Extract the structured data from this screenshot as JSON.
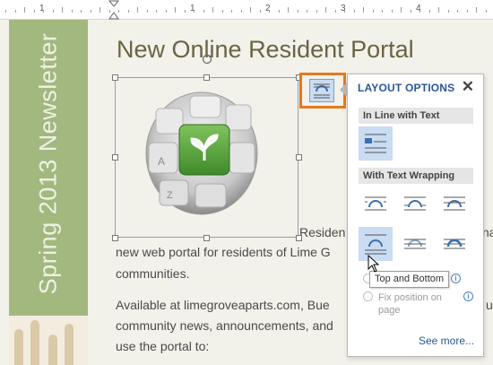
{
  "ruler": {
    "numbers": [
      "1",
      "1",
      "2",
      "3",
      "4"
    ]
  },
  "sidebar": {
    "text": "Spring 2013 Newsletter"
  },
  "document": {
    "title": "New Online Resident Portal",
    "lines": [
      "Residen",
      "na",
      "new web portal for residents of Lime G",
      "communities.",
      "Available at limegroveaparts.com, Bue",
      "u",
      "community news, announcements, and",
      "use the portal to:"
    ]
  },
  "layout_panel": {
    "title": "LAYOUT OPTIONS",
    "close": "✕",
    "section_inline": "In Line with Text",
    "section_wrapping": "With Text Wrapping",
    "tooltip": "Top and Bottom",
    "radio_partial": "",
    "radio_fix": "Fix position on page",
    "see_more": "See more...",
    "info": "i"
  },
  "icons": [
    "rotate-handle-icon",
    "layout-options-icon",
    "close-icon",
    "info-icon",
    "mouse-pointer-icon",
    "image-keyboard-key"
  ],
  "colors": {
    "accent": "#2b579a",
    "highlight": "#e17a1f",
    "selected": "#c9dcf2",
    "sidebar": "#a3b87e"
  }
}
